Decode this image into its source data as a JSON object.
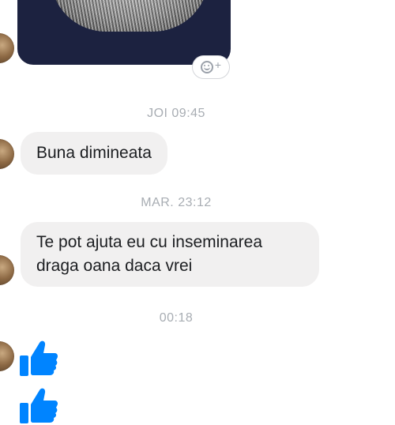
{
  "conversation": {
    "timestamps": [
      "JOI 09:45",
      "MAR. 23:12",
      "00:18"
    ],
    "messages": [
      {
        "text": "Buna dimineata"
      },
      {
        "text": "Te pot ajuta eu cu inseminarea draga oana daca vrei"
      }
    ],
    "reaction_button": {
      "icon": "smiley-plus-icon",
      "plus": "+"
    },
    "like_color": "#0084ff"
  }
}
